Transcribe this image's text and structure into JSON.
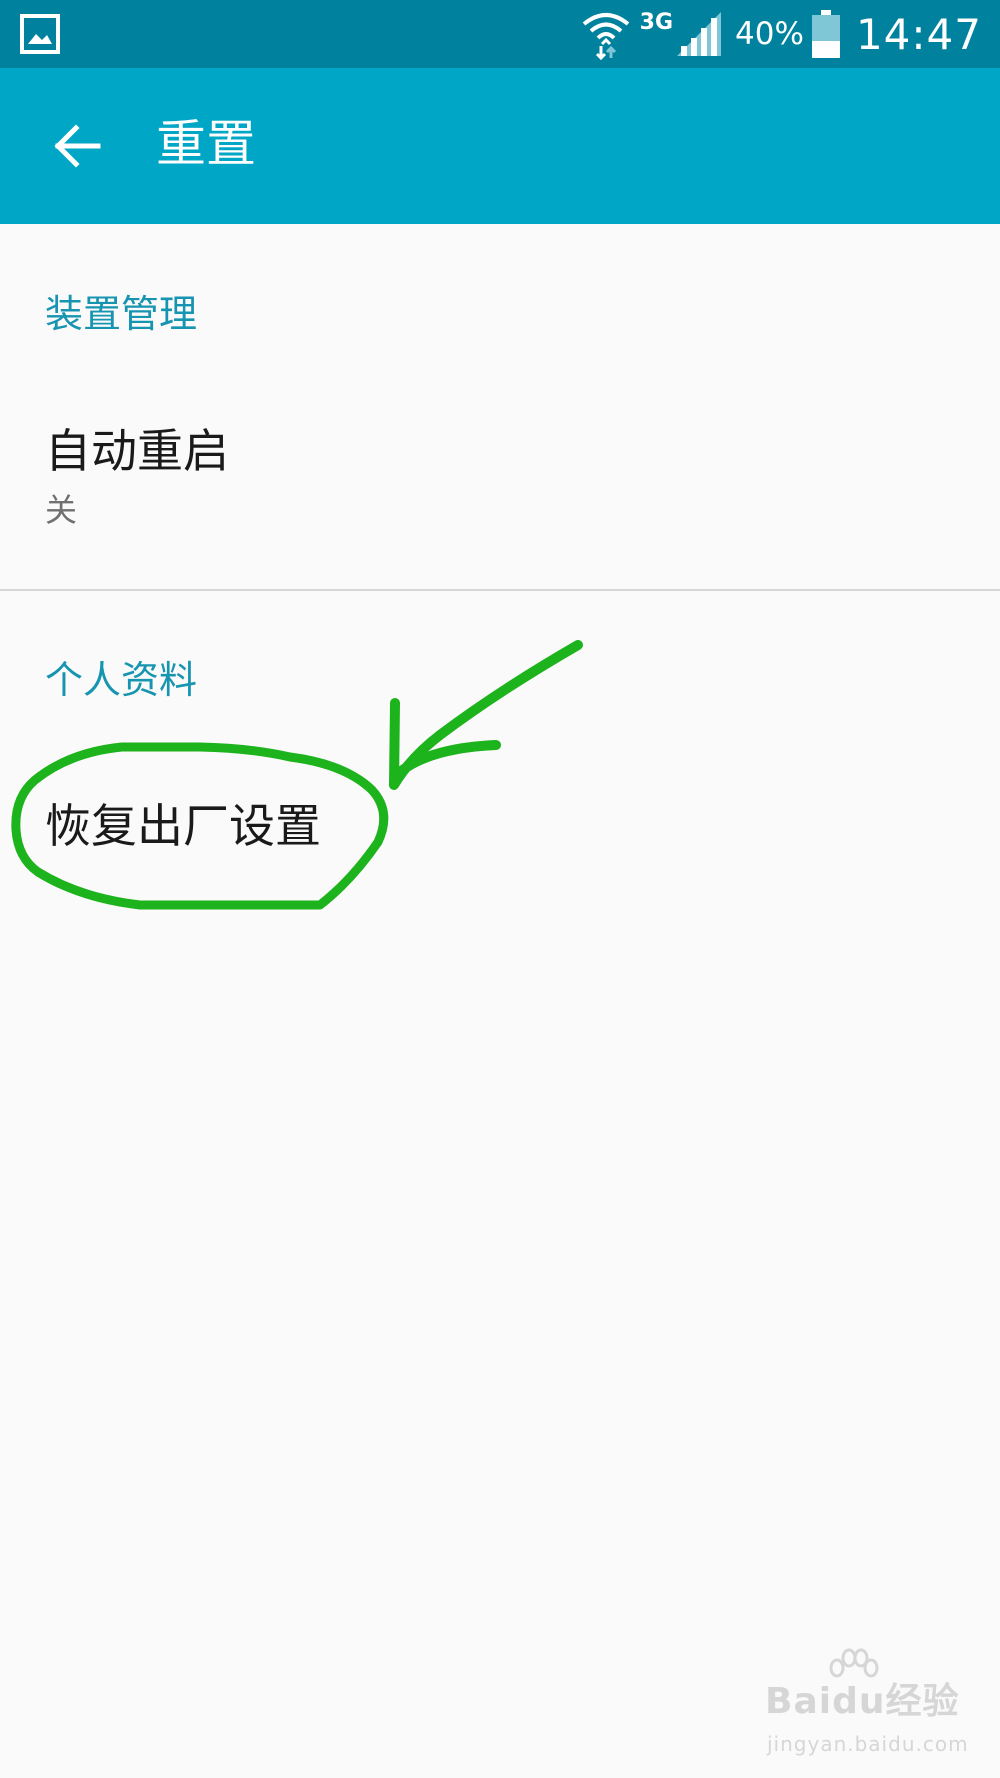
{
  "status_bar": {
    "network_type": "3G",
    "battery_percent": "40%",
    "time": "14:47",
    "battery_level": 0.4,
    "icons": [
      "gallery-icon",
      "wifi-icon",
      "signal-icon",
      "battery-icon"
    ]
  },
  "app_bar": {
    "title": "重置",
    "back_icon": "arrow-left-icon"
  },
  "sections": [
    {
      "header": "装置管理",
      "items": [
        {
          "title": "自动重启",
          "subtitle": "关"
        }
      ]
    },
    {
      "header": "个人资料",
      "items": [
        {
          "title": "恢复出厂设置"
        }
      ]
    }
  ],
  "watermark": {
    "brand": "Baidu经验",
    "url": "jingyan.baidu.com"
  },
  "colors": {
    "status_bar": "#00829f",
    "app_bar": "#00a6c5",
    "section_header": "#1694b0",
    "annotation": "#1db31d",
    "background": "#fafafa"
  }
}
